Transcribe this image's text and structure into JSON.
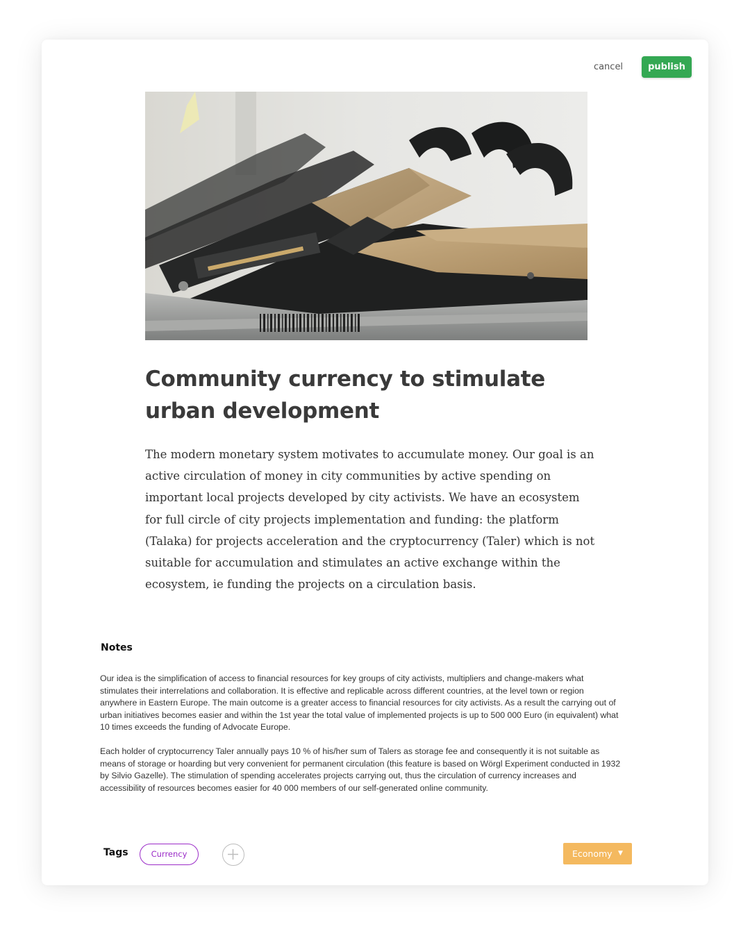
{
  "toolbar": {
    "cancel_label": "cancel",
    "publish_label": "publish"
  },
  "hero_image": {
    "icon": "gpu-mining-rig-photo"
  },
  "article": {
    "title": "Community currency to stimulate urban development",
    "body": "The modern monetary system motivates to accumulate money. Our goal is an active circulation of money in city communities by active spending on important local projects developed by city activists. We have an ecosystem for full circle of city projects implementation and funding: the platform (Talaka) for projects acceleration and the cryptocurrency (Taler) which is not suitable for accumulation and stimulates an active exchange within the ecosystem, ie funding the projects on a circulation basis."
  },
  "notes": {
    "heading": "Notes",
    "paragraphs": [
      "Our idea is the simplification of access to financial resources for key groups of city activists, multipliers and change-makers what stimulates their interrelations and collaboration. It is effective and replicable across different countries, at the level town or region anywhere in Eastern Europe. The main outcome is a greater access to financial resources for city activists. As a result the carrying out of urban initiatives becomes easier and within the 1st year the total value of implemented projects is up to 500 000 Euro (in equivalent) what 10 times exceeds the funding of Advocate Europe.",
      "Each holder of cryptocurrency Taler annually pays 10 % of his/her sum of Talers as storage fee and consequently it is not suitable as means of storage or hoarding but very convenient for permanent circulation (this feature is based on Wörgl Experiment conducted in 1932 by Silvio Gazelle). The stimulation of spending accelerates projects carrying out, thus the circulation of currency increases and accessibility of resources becomes easier for 40 000 members of our self-generated online community."
    ]
  },
  "tags": {
    "label": "Tags",
    "items": [
      "Currency"
    ],
    "add_icon": "plus-icon"
  },
  "category": {
    "selected": "Economy",
    "icon": "caret-down-icon"
  },
  "colors": {
    "publish": "#34a853",
    "tag": "#9b2cc8",
    "category": "#f4b95f"
  }
}
